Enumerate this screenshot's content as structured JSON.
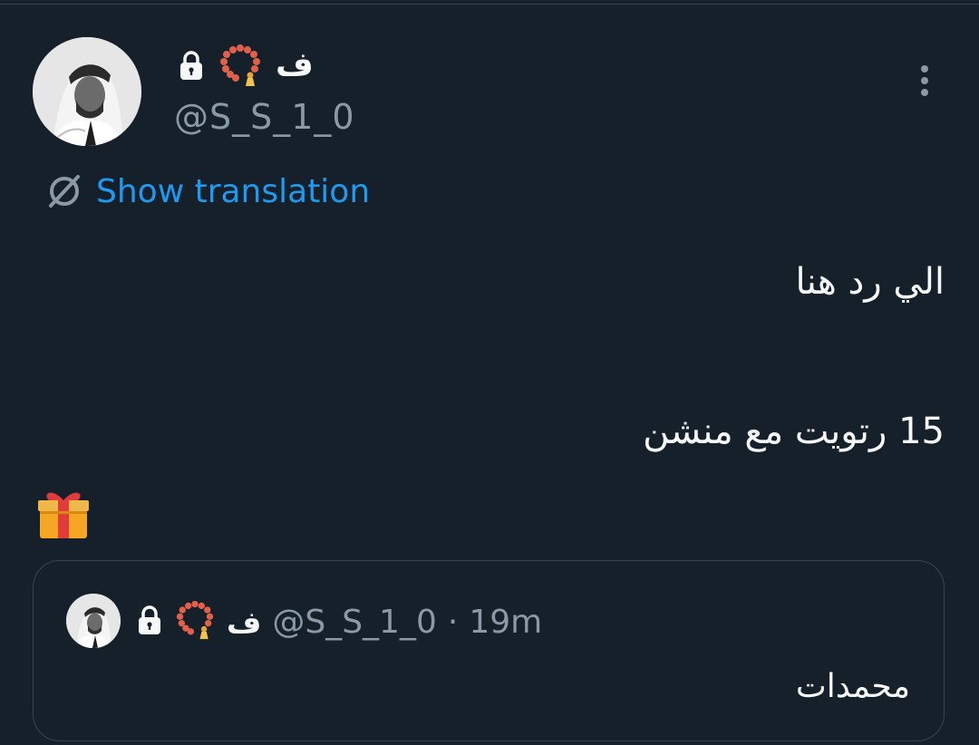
{
  "tweet": {
    "author": {
      "display_name": "ف",
      "handle": "@S_S_1_0",
      "avatar_icon": "avatar-photo",
      "badges": [
        "lock-icon",
        "prayer-beads-icon"
      ]
    },
    "more_icon": "more-vertical-icon",
    "translation_label": "Show translation",
    "text_lines": [
      "الي رد هنا",
      "15 رتويت مع منشن"
    ],
    "emoji_icon": "gift-icon"
  },
  "quote": {
    "display_name": "ف",
    "handle": "@S_S_1_0",
    "separator": "·",
    "time": "19m",
    "text": "محمدات"
  },
  "colors": {
    "background": "#15202b",
    "border": "#38444d",
    "link": "#1d9bf0",
    "secondary_text": "#8b98a5",
    "primary_text": "#f7f9f9"
  }
}
